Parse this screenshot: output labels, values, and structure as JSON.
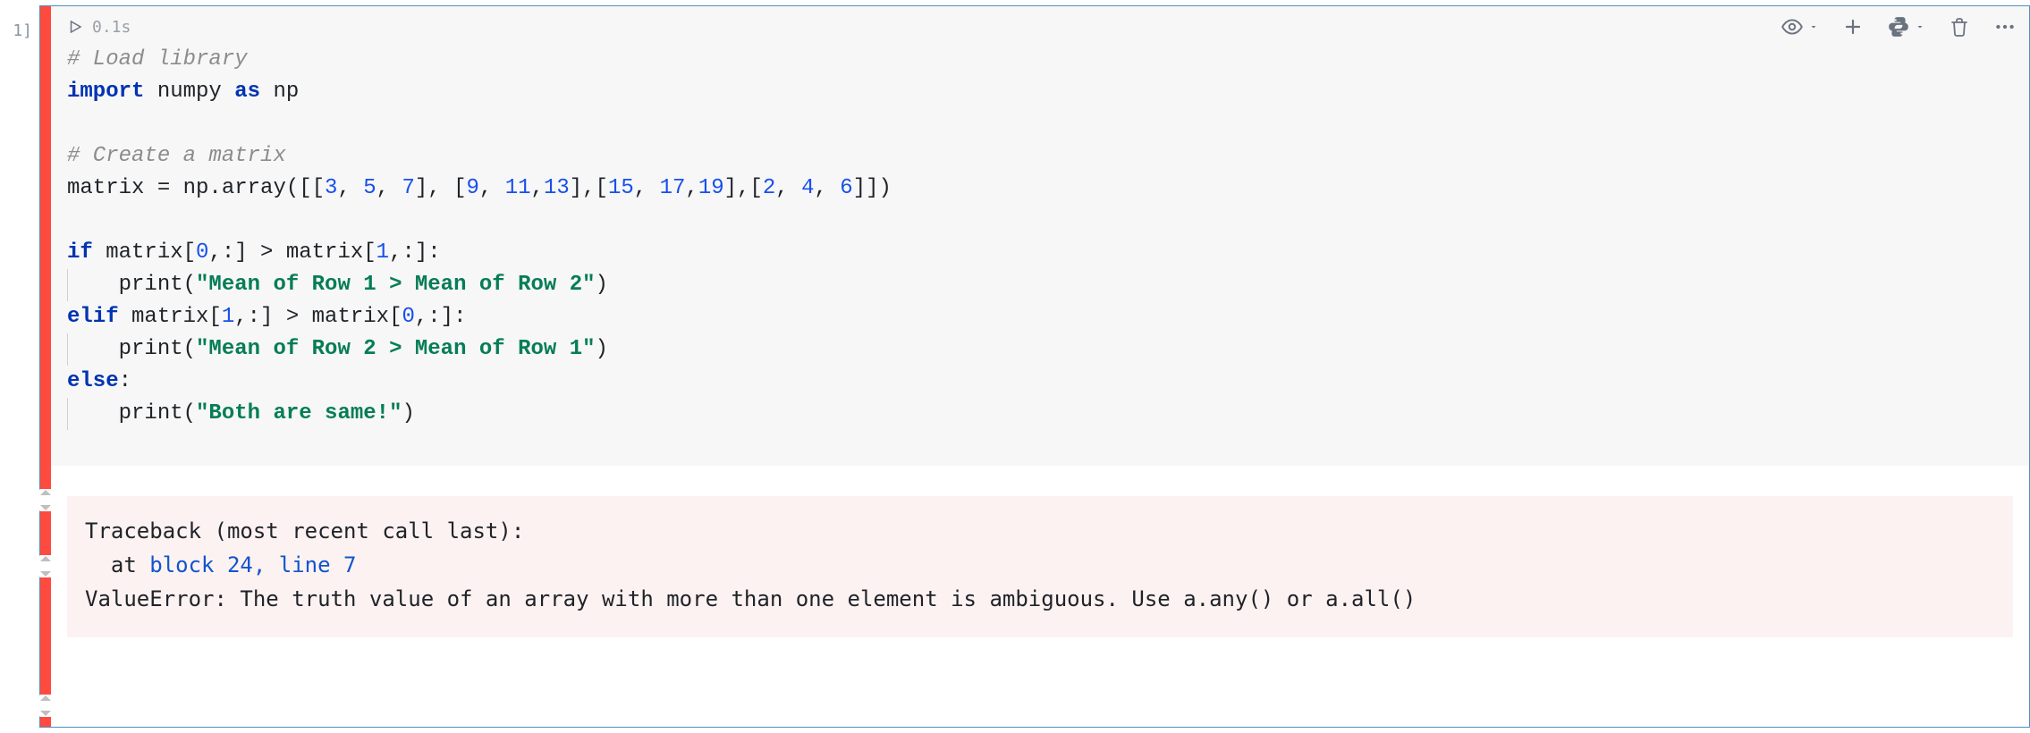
{
  "cell": {
    "prompt_label": "1]",
    "exec_time": "0.1s"
  },
  "code": {
    "l1_comment": "# Load library",
    "l2_kw1": "import",
    "l2_mod": " numpy ",
    "l2_kw2": "as",
    "l2_alias": " np",
    "l4_comment": "# Create a matrix",
    "l5_lhs": "matrix = np.array([[",
    "l5_n1": "3",
    "l5_c1": ", ",
    "l5_n2": "5",
    "l5_c2": ", ",
    "l5_n3": "7",
    "l5_m1": "], [",
    "l5_n4": "9",
    "l5_c3": ", ",
    "l5_n5": "11",
    "l5_c4": ",",
    "l5_n6": "13",
    "l5_m2": "],[",
    "l5_n7": "15",
    "l5_c5": ", ",
    "l5_n8": "17",
    "l5_c6": ",",
    "l5_n9": "19",
    "l5_m3": "],[",
    "l5_n10": "2",
    "l5_c7": ", ",
    "l5_n11": "4",
    "l5_c8": ", ",
    "l5_n12": "6",
    "l5_end": "]])",
    "l7_if": "if",
    "l7_a": " matrix[",
    "l7_z0a": "0",
    "l7_b": ",:] > matrix[",
    "l7_z1a": "1",
    "l7_c": ",:]:",
    "l8_indent": "    ",
    "l8_print": "print",
    "l8_open": "(",
    "l8_str": "\"Mean of Row 1 > Mean of Row 2\"",
    "l8_close": ")",
    "l9_elif": "elif",
    "l9_a": " matrix[",
    "l9_z1": "1",
    "l9_b": ",:] > matrix[",
    "l9_z0": "0",
    "l9_c": ",:]:",
    "l10_indent": "    ",
    "l10_print": "print",
    "l10_open": "(",
    "l10_str": "\"Mean of Row 2 > Mean of Row 1\"",
    "l10_close": ")",
    "l11_else": "else",
    "l11_colon": ":",
    "l12_indent": "    ",
    "l12_print": "print",
    "l12_open": "(",
    "l12_str": "\"Both are same!\"",
    "l12_close": ")"
  },
  "traceback": {
    "line1": "Traceback (most recent call last):",
    "line2_prefix": "  at ",
    "line2_link": "block 24, line 7",
    "line3_a": "ValueError",
    "line3_b": ": The truth value of an array with more than one element is ambiguous. Use a.any() or a.all()"
  },
  "icons": {
    "run": "run-icon",
    "visibility": "visibility-icon",
    "add": "add-icon",
    "python": "python-icon",
    "delete": "delete-icon",
    "more": "more-icon"
  },
  "colors": {
    "cell_border": "#4c90c2",
    "error_marker": "#ff4a3f",
    "input_bg": "#f7f7f7",
    "output_bg": "#fdf2f2",
    "comment": "#8c8c8c",
    "keyword": "#0033b3",
    "number": "#1750eb",
    "string": "#067d57",
    "link": "#1155cc"
  }
}
